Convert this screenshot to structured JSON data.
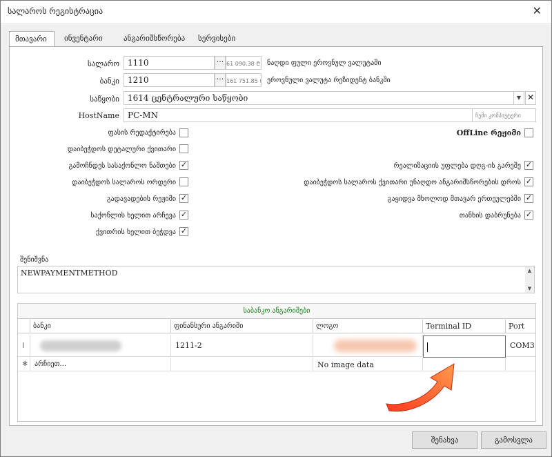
{
  "window": {
    "title": "სალაროს რეგისტრაცია",
    "close_glyph": "✕"
  },
  "tabs": [
    {
      "label": "მთავარი"
    },
    {
      "label": "ინვენტარი"
    },
    {
      "label": "ანგარიშსწორება"
    },
    {
      "label": "სერვისები"
    }
  ],
  "form": {
    "cashbox": {
      "label": "სალარო",
      "value": "1110",
      "amount": "61 090.38 ₾",
      "note": "ნაღდი ფული ეროვნულ ვალუტაში"
    },
    "bank": {
      "label": "ბანკი",
      "value": "1210",
      "amount": "161 751.85 ₾",
      "note": "ეროვნული ვალუტა რეზიდენტ ბანკში"
    },
    "warehouse": {
      "label": "საწყობი",
      "value": "1614   ცენტრალური საწყობი"
    },
    "hostname": {
      "label": "HostName",
      "value": "PC-MN",
      "hint": "ჩემი კომპიუტერი"
    },
    "dots_glyph": "···",
    "dropdown_glyph": "▼",
    "clear_glyph": "✕"
  },
  "checks_left": [
    {
      "label": "ფასის რედაქტირება",
      "checked": false
    },
    {
      "label": "დაიბეჭდოს დეტალური ქვითარი",
      "checked": false
    },
    {
      "label": "გამოჩნდეს სასაქონლო ნაშთები",
      "checked": true
    },
    {
      "label": "დაიბეჭდოს სალაროს ორდერი",
      "checked": false
    },
    {
      "label": "გადავადების რეჟიმი",
      "checked": true
    },
    {
      "label": "საქონლის ხელით არჩევა",
      "checked": true
    },
    {
      "label": "ქვითრის ხელით ბეჭდვა",
      "checked": true
    }
  ],
  "checks_right": [
    {
      "label": "OffLine რეჟიმი",
      "checked": false
    },
    {
      "label": "რეალიზაციის უფლება დღგ-ის გარეშე",
      "checked": true
    },
    {
      "label": "დაიბეჭდოს სალაროს ქვითარი უნაღდო ანგარიშსწორების დროს",
      "checked": true
    },
    {
      "label": "გაყიდვა მხოლოდ მთავარ ერთეულებში",
      "checked": true
    },
    {
      "label": "თანხის დაბრუნება",
      "checked": true
    }
  ],
  "check_glyph": "✓",
  "memo": {
    "label": "შენიშვნა",
    "value": "NEWPAYMENTMETHOD",
    "up_glyph": "▲",
    "down_glyph": "▼"
  },
  "grid": {
    "caption": "საბანკო ანგარიშები",
    "columns": [
      "ბანკი",
      "ფინანსური ანგარიში",
      "ლოგო",
      "Terminal ID",
      "Port"
    ],
    "row": {
      "marker": "I",
      "bank": "",
      "account": "1211-2",
      "logo": "",
      "terminal_id": "",
      "port": "COM3"
    },
    "new_row": {
      "marker": "✱",
      "placeholder": "არჩიეთ...",
      "logo_text": "No image data"
    }
  },
  "buttons": {
    "save": "შენახვა",
    "exit": "გამოსვლა"
  },
  "colors": {
    "grid_caption": "#1a7a1a",
    "arrow_start": "#ff3b1f",
    "arrow_end": "#ff9a4d"
  }
}
